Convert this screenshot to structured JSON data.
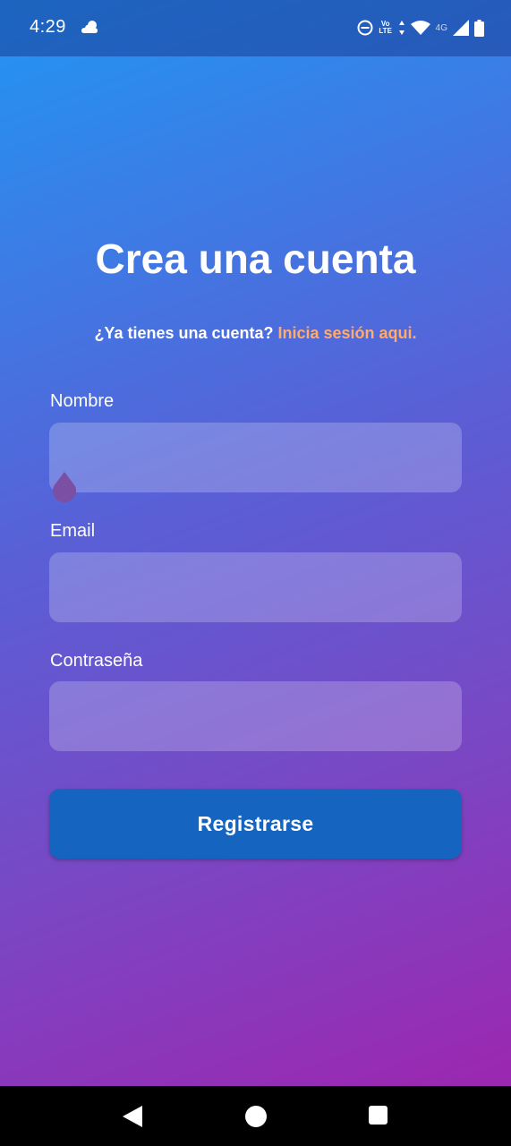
{
  "status_bar": {
    "time": "4:29",
    "volte_line1": "Vo",
    "volte_line2": "LTE",
    "network": "4G",
    "icons": [
      "weather-icon",
      "dnd-icon",
      "volte-icon",
      "data-arrows-icon",
      "wifi-icon",
      "signal-icon",
      "battery-icon"
    ]
  },
  "page": {
    "title": "Crea una cuenta",
    "subtitle_prefix": "¿Ya tienes una cuenta? ",
    "login_link": "Inicia sesión aqui."
  },
  "form": {
    "name_label": "Nombre",
    "name_value": "",
    "email_label": "Email",
    "email_value": "",
    "password_label": "Contraseña",
    "password_value": "",
    "submit_label": "Registrarse"
  },
  "colors": {
    "gradient_start": "#2196F3",
    "gradient_end": "#9C27B0",
    "link": "#FFAB6B",
    "button": "#1565C0"
  },
  "nav": {
    "icons": [
      "back-icon",
      "home-icon",
      "recents-icon"
    ]
  }
}
